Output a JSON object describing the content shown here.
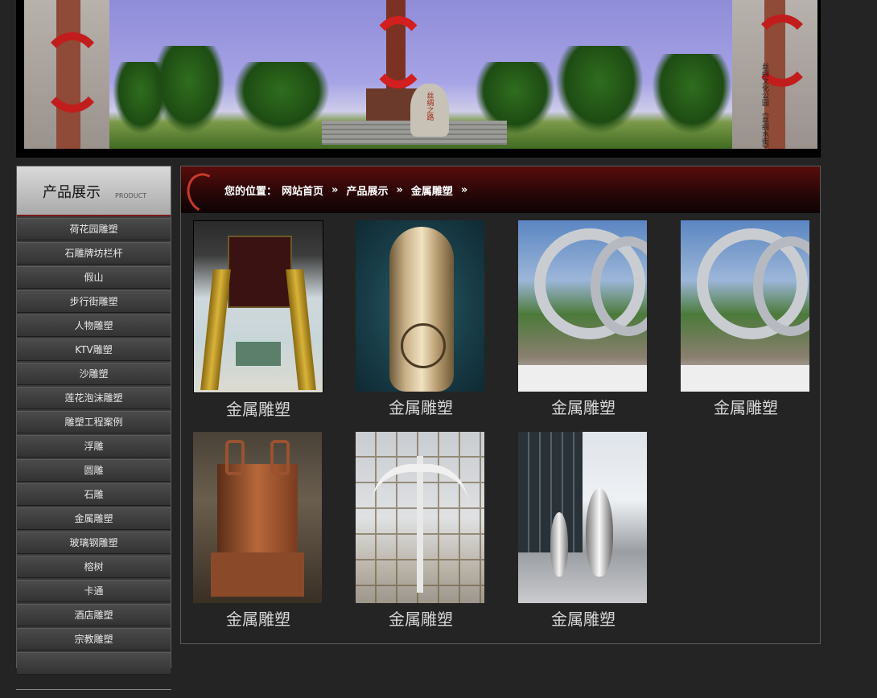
{
  "banner": {
    "stone_text": "丝绸之路",
    "side_text": "丝绸文化公园 《丝绸水街》"
  },
  "sidebar": {
    "title": "产品展示",
    "subtitle": "PRODUCT",
    "items": [
      {
        "label": "荷花园雕塑"
      },
      {
        "label": "石雕牌坊栏杆"
      },
      {
        "label": "假山"
      },
      {
        "label": "步行街雕塑"
      },
      {
        "label": "人物雕塑"
      },
      {
        "label": "KTV雕塑"
      },
      {
        "label": "沙雕塑"
      },
      {
        "label": "莲花泡沫雕塑"
      },
      {
        "label": "雕塑工程案例"
      },
      {
        "label": "浮雕"
      },
      {
        "label": "圆雕"
      },
      {
        "label": "石雕"
      },
      {
        "label": "金属雕塑"
      },
      {
        "label": "玻璃钢雕塑"
      },
      {
        "label": "榕树"
      },
      {
        "label": "卡通"
      },
      {
        "label": "酒店雕塑"
      },
      {
        "label": "宗教雕塑"
      }
    ]
  },
  "breadcrumb": {
    "prefix": "您的位置：",
    "home": "网站首页",
    "sep": "»",
    "level1": "产品展示",
    "level2": "金属雕塑"
  },
  "products": [
    {
      "caption": "金属雕塑",
      "image": "lobby-ceiling-photo"
    },
    {
      "caption": "金属雕塑",
      "image": "bronze-hand-photo"
    },
    {
      "caption": "金属雕塑",
      "image": "steel-ring-sculpture-photo"
    },
    {
      "caption": "金属雕塑",
      "image": "steel-ring-sculpture-photo"
    },
    {
      "caption": "金属雕塑",
      "image": "bronze-ding-photo"
    },
    {
      "caption": "金属雕塑",
      "image": "steel-wing-scaffold-photo"
    },
    {
      "caption": "金属雕塑",
      "image": "steel-droplet-photo"
    }
  ],
  "colors": {
    "page_bg": "#242424",
    "accent_red": "#c21d1d",
    "caption_text": "#d6d6d6"
  }
}
